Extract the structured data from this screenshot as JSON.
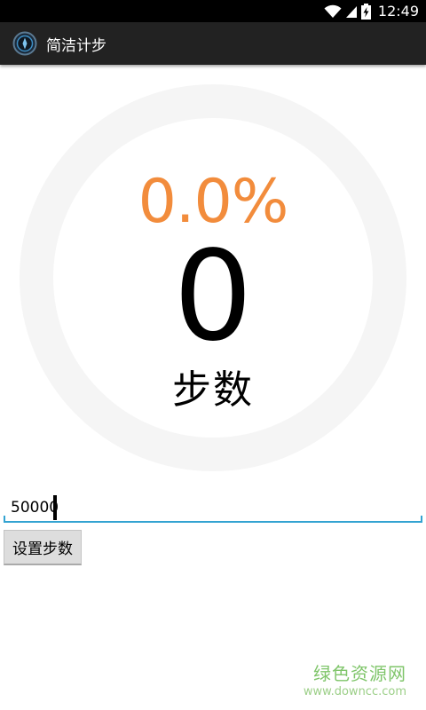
{
  "status_bar": {
    "time": "12:49",
    "icons": [
      "wifi-icon",
      "signal-icon",
      "battery-charging-icon"
    ]
  },
  "action_bar": {
    "icon": "app-logo-icon",
    "title": "简洁计步"
  },
  "progress": {
    "percent_text": "0.0%",
    "percent_value": 0.0,
    "steps": "0",
    "steps_label": "步数"
  },
  "goal_input": {
    "value": "50000"
  },
  "set_button": {
    "label": "设置步数"
  },
  "watermark": {
    "text": "绿色资源网",
    "url": "www.downcc.com"
  },
  "colors": {
    "accent_orange": "#F28C3C",
    "ring_track": "#F5F5F5",
    "input_underline": "#33A3D1",
    "action_bar_bg": "#222222",
    "status_bar_bg": "#000000",
    "watermark_green": "#7FC56A"
  }
}
